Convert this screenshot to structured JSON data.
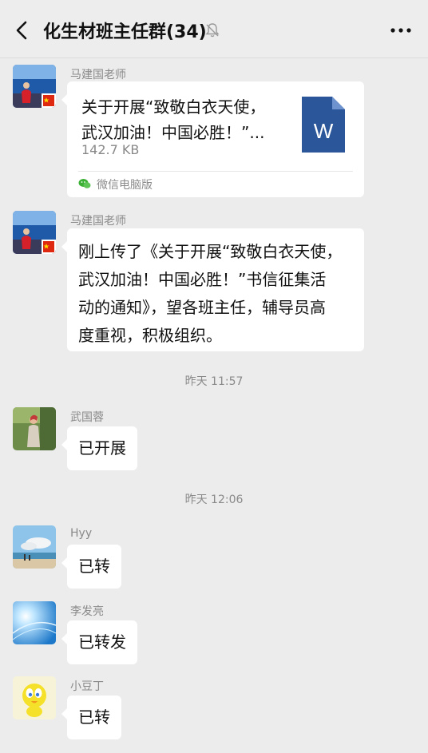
{
  "header": {
    "title": "化生材班主任群(34)",
    "back_icon": "chevron-left-icon",
    "mute_icon": "bell-muted-icon",
    "more_icon": "more-dots-icon"
  },
  "messages": [
    {
      "type": "file",
      "sender": "马建国老师",
      "avatar": "person-by-sea-avatar",
      "file": {
        "name_line1": "关于开展“致敬白衣天使，",
        "name_line2": "武汉加油！中国必胜！”...",
        "size": "142.7 KB",
        "icon": "word-file-icon",
        "icon_letter": "W",
        "source": "微信电脑版"
      }
    },
    {
      "type": "text",
      "sender": "马建国老师",
      "avatar": "person-by-sea-avatar",
      "lines": [
        "刚上传了《关于开展“致敬白衣天使，",
        "武汉加油！中国必胜！”书信征集活",
        "动的通知》，望各班主任，辅导员高",
        "度重视，积极组织。"
      ]
    },
    {
      "type": "time",
      "text": "昨天 11:57"
    },
    {
      "type": "text",
      "sender": "武国蓉",
      "avatar": "woman-outdoors-avatar",
      "text": "已开展"
    },
    {
      "type": "time",
      "text": "昨天 12:06"
    },
    {
      "type": "text",
      "sender": "Hyy",
      "avatar": "beach-sky-avatar",
      "text": "已转"
    },
    {
      "type": "text",
      "sender": "李发亮",
      "avatar": "blue-light-avatar",
      "text": "已转发"
    },
    {
      "type": "text",
      "sender": "小豆丁",
      "avatar": "tweety-bird-avatar",
      "text": "已转"
    }
  ],
  "colors": {
    "background": "#ececec",
    "bubble": "#ffffff",
    "word_blue": "#2b579a",
    "meta_text": "#8a8a8a",
    "wechat_green": "#3cb034"
  }
}
